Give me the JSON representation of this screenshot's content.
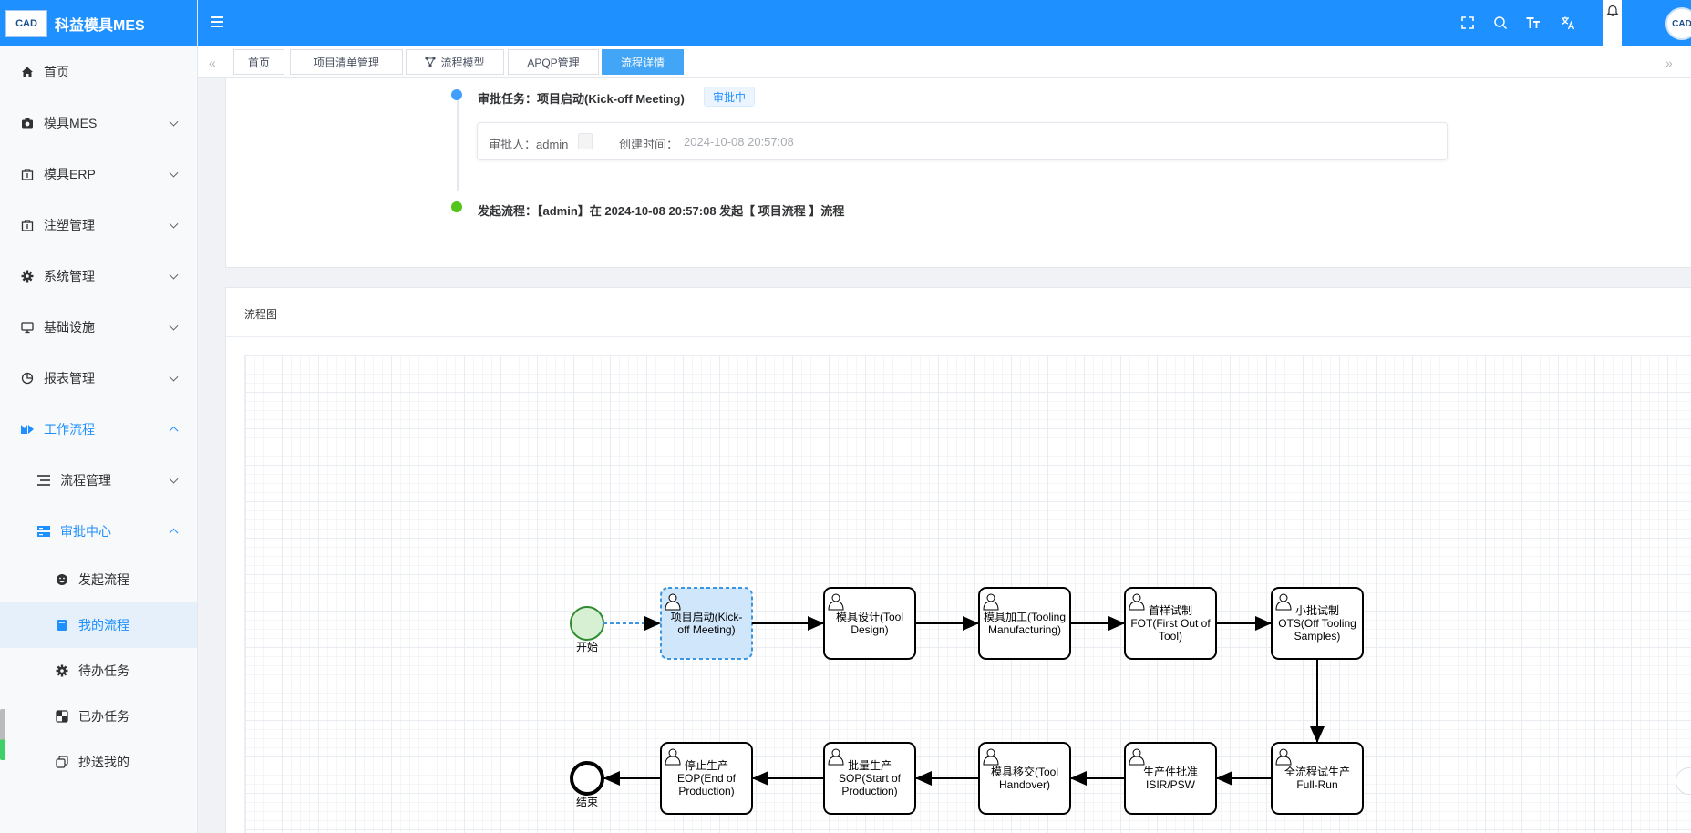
{
  "app": {
    "title": "科益模具MES",
    "logo_text": "CAD"
  },
  "sidebar": {
    "items": [
      {
        "label": "首页",
        "icon": "home-icon"
      },
      {
        "label": "模具MES",
        "icon": "camera-icon"
      },
      {
        "label": "模具ERP",
        "icon": "bag-icon"
      },
      {
        "label": "注塑管理",
        "icon": "bag-icon"
      },
      {
        "label": "系统管理",
        "icon": "gear-icon"
      },
      {
        "label": "基础设施",
        "icon": "monitor-icon"
      },
      {
        "label": "报表管理",
        "icon": "pie-icon"
      },
      {
        "label": "工作流程",
        "icon": "workflow-icon"
      }
    ],
    "sub_items": [
      {
        "label": "流程管理",
        "icon": "list-icon"
      },
      {
        "label": "审批中心",
        "icon": "server-icon"
      }
    ],
    "leaf_items": [
      {
        "label": "发起流程",
        "icon": "smile-icon"
      },
      {
        "label": "我的流程",
        "icon": "book-icon"
      },
      {
        "label": "待办任务",
        "icon": "gear-icon"
      },
      {
        "label": "已办任务",
        "icon": "checker-icon"
      },
      {
        "label": "抄送我的",
        "icon": "copy-icon"
      }
    ]
  },
  "header": {
    "icons": [
      "fullscreen-icon",
      "search-icon",
      "font-size-icon",
      "translate-icon",
      "bell-icon"
    ]
  },
  "tabs": [
    {
      "label": "首页"
    },
    {
      "label": "项目清单管理"
    },
    {
      "label": "流程模型"
    },
    {
      "label": "APQP管理"
    },
    {
      "label": "流程详情",
      "active": true
    }
  ],
  "timeline": {
    "task_title": "审批任务：项目启动(Kick-off Meeting)",
    "task_status": "审批中",
    "approver_label": "审批人：admin",
    "created_label": "创建时间：",
    "created_time": "2024-10-08 20:57:08",
    "start_text": "发起流程：【admin】在 2024-10-08 20:57:08 发起【 项目流程 】流程"
  },
  "diagram": {
    "card_title": "流程图",
    "start_label": "开始",
    "end_label": "结束",
    "row1": [
      [
        "项目启动(Kick-",
        "off Meeting)"
      ],
      [
        "模具设计(Tool",
        "Design)"
      ],
      [
        "模具加工(Tooling",
        "Manufacturing)"
      ],
      [
        "首样试制",
        "FOT(First Out of",
        "Tool)"
      ],
      [
        "小批试制",
        "OTS(Off Tooling",
        "Samples)"
      ]
    ],
    "row2": [
      [
        "停止生产",
        "EOP(End of",
        "Production)"
      ],
      [
        "批量生产",
        "SOP(Start of",
        "Production)"
      ],
      [
        "模具移交(Tool",
        "Handover)"
      ],
      [
        "生产件批准",
        "ISIR/PSW"
      ],
      [
        "全流程试生产",
        "Full-Run"
      ]
    ]
  }
}
